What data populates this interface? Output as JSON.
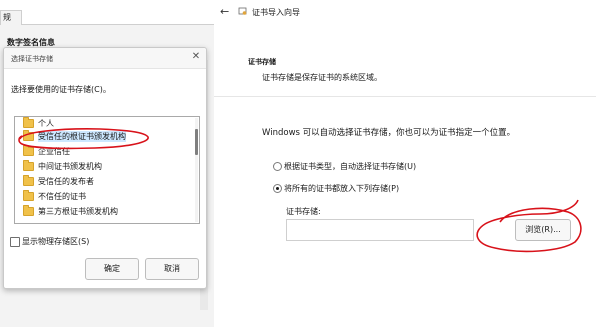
{
  "background_window": {
    "tab_label": "规",
    "section_label": "数字签名信息"
  },
  "dialog": {
    "title": "选择证书存储",
    "prompt": "选择要使用的证书存储(C)。",
    "tree_items": [
      "个人",
      "受信任的根证书颁发机构",
      "企业信任",
      "中间证书颁发机构",
      "受信任的发布者",
      "不信任的证书",
      "第三方根证书颁发机构"
    ],
    "selected_index": 1,
    "show_physical_label": "显示物理存储区(S)",
    "show_physical_checked": false,
    "ok_label": "确定",
    "cancel_label": "取消"
  },
  "wizard": {
    "title": "证书导入向导",
    "section_title": "证书存储",
    "section_desc": "证书存储是保存证书的系统区域。",
    "info": "Windows 可以自动选择证书存储，你也可以为证书指定一个位置。",
    "option_auto": "根据证书类型，自动选择证书存储(U)",
    "option_manual": "将所有的证书都放入下列存储(P)",
    "selected_option": "manual",
    "store_label": "证书存储:",
    "store_value": "",
    "browse_label": "浏览(R)..."
  },
  "annotation_color": "#d8121a"
}
